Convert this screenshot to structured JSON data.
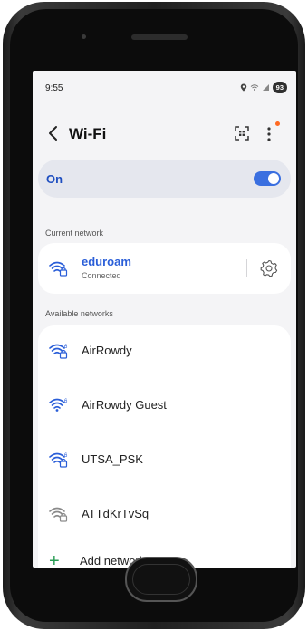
{
  "status_bar": {
    "time": "9:55",
    "battery": "93",
    "icons": [
      "location-icon",
      "wifi-signal-icon",
      "cell-signal-icon"
    ]
  },
  "header": {
    "title": "Wi-Fi",
    "back_icon": "chevron-left-icon",
    "qr_icon": "qr-scan-icon",
    "more_icon": "more-vert-icon",
    "notification_dot_color": "#ff6a22"
  },
  "wifi_toggle": {
    "label": "On",
    "state": true,
    "accent_color": "#3a6fe0"
  },
  "current_network": {
    "section_label": "Current network",
    "name": "eduroam",
    "status": "Connected",
    "secured": true,
    "settings_icon": "gear-icon"
  },
  "available_networks": {
    "section_label": "Available networks",
    "items": [
      {
        "name": "AirRowdy",
        "secured": true,
        "wifi6": true
      },
      {
        "name": "AirRowdy Guest",
        "secured": false,
        "wifi6": true
      },
      {
        "name": "UTSA_PSK",
        "secured": true,
        "wifi6": true
      },
      {
        "name": "ATTdKrTvSq",
        "secured": true,
        "wifi6": false
      }
    ],
    "add_label": "Add network"
  }
}
